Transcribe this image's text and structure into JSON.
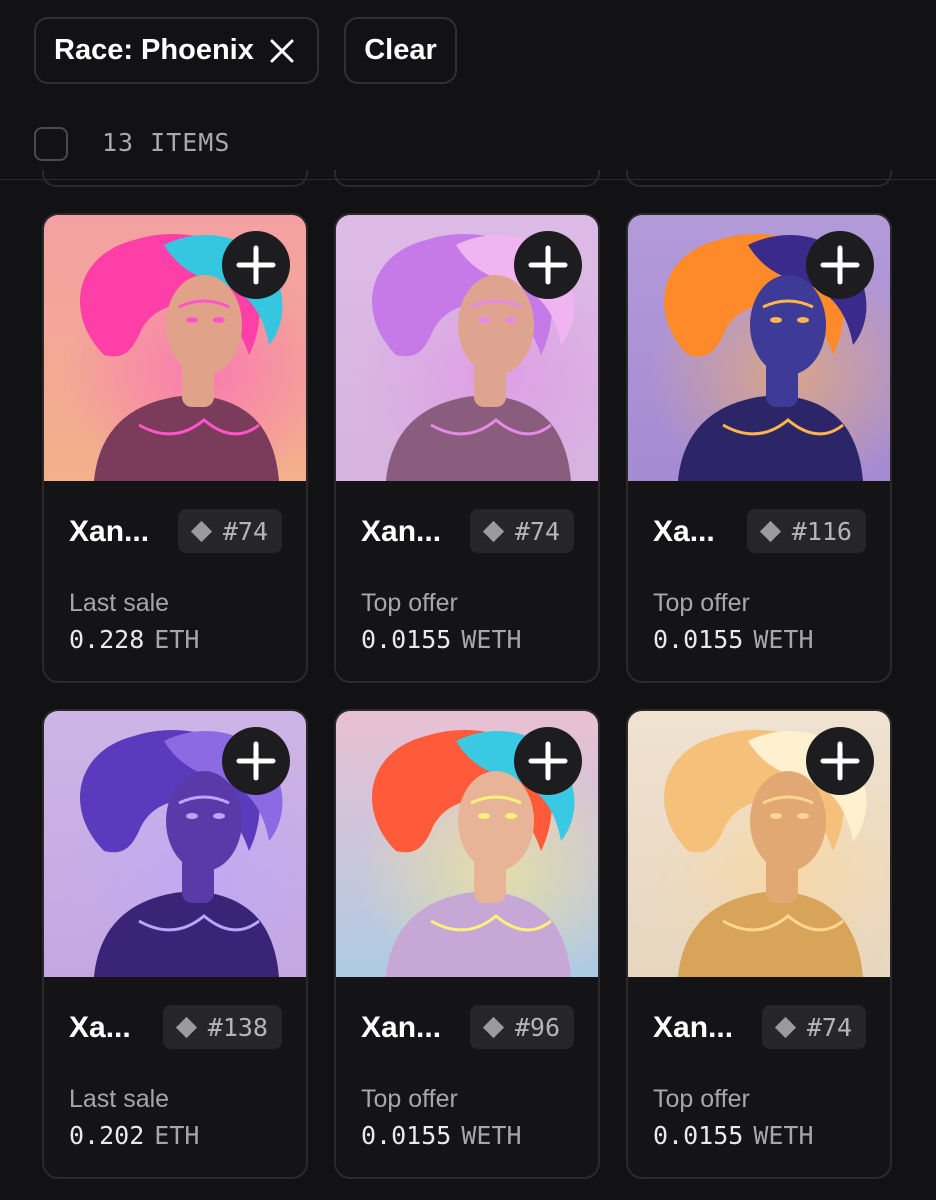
{
  "filters": {
    "race_chip_label": "Race: Phoenix",
    "clear_label": "Clear"
  },
  "results": {
    "count_label": "13 ITEMS"
  },
  "cards": [
    {
      "name": "Xan...",
      "rank": "#74",
      "price_label": "Last sale",
      "price_value": "0.228",
      "price_currency": "ETH",
      "art": {
        "bg_top": "#f4a0a2",
        "bg_bottom": "#f3b08a",
        "hair1": "#ff3fa8",
        "hair2": "#35c7e0",
        "skin": "#e0a38a",
        "glow": "#ff55c8",
        "outfit": "#7a3c5a"
      }
    },
    {
      "name": "Xan...",
      "rank": "#74",
      "price_label": "Top offer",
      "price_value": "0.0155",
      "price_currency": "WETH",
      "art": {
        "bg_top": "#ddbbe6",
        "bg_bottom": "#d6b4df",
        "hair1": "#c57ae8",
        "hair2": "#f0b4f2",
        "skin": "#dfa48f",
        "glow": "#e58ae6",
        "outfit": "#8a5c7e"
      }
    },
    {
      "name": "Xa...",
      "rank": "#116",
      "price_label": "Top offer",
      "price_value": "0.0155",
      "price_currency": "WETH",
      "art": {
        "bg_top": "#b39ad9",
        "bg_bottom": "#a48bd2",
        "hair1": "#ff8a2a",
        "hair2": "#3a2a8a",
        "skin": "#3e3a98",
        "glow": "#ffb54a",
        "outfit": "#2c2668"
      }
    },
    {
      "name": "Xa...",
      "rank": "#138",
      "price_label": "Last sale",
      "price_value": "0.202",
      "price_currency": "ETH",
      "art": {
        "bg_top": "#cdb5e6",
        "bg_bottom": "#c4a7e2",
        "hair1": "#5b3bbd",
        "hair2": "#8c6ae4",
        "skin": "#5a3aa8",
        "glow": "#b9a6ff",
        "outfit": "#3a2478"
      }
    },
    {
      "name": "Xan...",
      "rank": "#96",
      "price_label": "Top offer",
      "price_value": "0.0155",
      "price_currency": "WETH",
      "art": {
        "bg_top": "#e9c0d2",
        "bg_bottom": "#aecbe4",
        "hair1": "#ff5a3a",
        "hair2": "#39c9e3",
        "skin": "#e7b497",
        "glow": "#fff07a",
        "outfit": "#c7a7d6"
      }
    },
    {
      "name": "Xan...",
      "rank": "#74",
      "price_label": "Top offer",
      "price_value": "0.0155",
      "price_currency": "WETH",
      "art": {
        "bg_top": "#efe2d0",
        "bg_bottom": "#e7d6c0",
        "hair1": "#f4c07a",
        "hair2": "#fff1cf",
        "skin": "#e2a874",
        "glow": "#ffd690",
        "outfit": "#d8a45a"
      }
    }
  ]
}
